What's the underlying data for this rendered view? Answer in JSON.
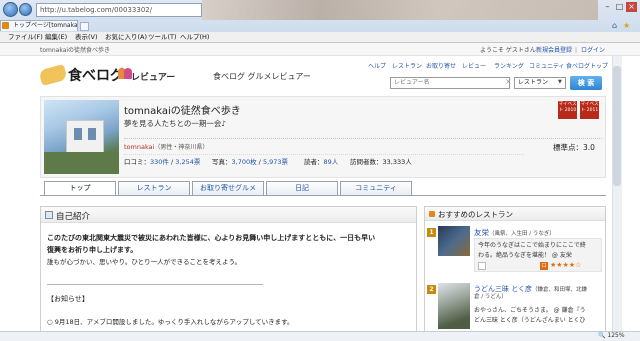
{
  "browser": {
    "address": "http://u.tabelog.com/00033302/",
    "tab_title": "トップページ[tomnakai...",
    "menu": [
      "ファイル(F)",
      "編集(E)",
      "表示(V)",
      "お気に入り(A)",
      "ツール(T)",
      "ヘルプ(H)"
    ],
    "zoom": "125%"
  },
  "site": {
    "tagline": "tomnakaiの徒然食べ歩き",
    "welcome": "ようこそ ゲストさん",
    "register": "新規会員登録",
    "login": "ログイン",
    "logo": "食べログ",
    "reviewer_word": "レビュアー",
    "subtitle": "食べログ グルメレビュアー",
    "links": [
      "ヘルプ",
      "レストラン",
      "お取り寄せ",
      "レビュー",
      "ランキング",
      "コミュニティ",
      "食べログトップ"
    ],
    "search_placeholder": "レビュアー名",
    "search_select": "レストラン",
    "search_button": "検 索"
  },
  "profile": {
    "title": "tomnakaiの徒然食べ歩き",
    "catch": "夢を見る人たちとの一期一会♪",
    "user": "tomnakai",
    "user_info": "（男性・神奈川県）",
    "reviews_label": "口コミ：",
    "reviews": "330件",
    "reviews_total": "3,254票",
    "photos_label": "写真：",
    "photos": "3,700枚",
    "photos_total": "5,973票",
    "readers_label": "読者：",
    "readers": "89人",
    "visitors_label": "訪問者数：",
    "visitors": "33,333人",
    "standard_label": "標準点：",
    "standard": "3.0",
    "badge1": "マイベスト 2010",
    "badge2": "マイベスト 2011"
  },
  "tabs": [
    "トップ",
    "レストラン",
    "お取り寄せグルメ",
    "日記",
    "コミュニティ"
  ],
  "intro": {
    "heading": "自己紹介",
    "line1": "このたびの東北関東大震災で被災にあわれた皆様に、心よりお見舞い申し上げますとともに、一日も早い",
    "line2": "復興をお祈り申し上げます。",
    "line3": "誰もが心づかい、思いやり。ひとり一人ができることを考えよう。",
    "divider": "――――――――――――――――――――――――――――――――――――",
    "notice": "【お知らせ】",
    "item": "○ 9月18日、アメブロ開設しました。ゆっくり手入れしながらアップしていきます。"
  },
  "recommend": {
    "heading": "おすすめのレストラン",
    "items": [
      {
        "rank": "1",
        "name": "友栄",
        "info": "（風祭、入生田 / うなぎ）",
        "text1": "今年のうなぎはここで始まりにここで終",
        "text2": "わる。絶品うなぎを堪能！ @ 友栄",
        "stars": "★★★★☆"
      },
      {
        "rank": "2",
        "name": "うどん三昧 とく彦",
        "info": "（鎌倉、和田塚、北鎌",
        "info2": "倉 / うどん）",
        "text1": "おやっさん、ごちそうさま。 @ 鎌倉『う",
        "text2": "どん三昧 とく彦（うどんざんまい とくひ"
      }
    ]
  }
}
